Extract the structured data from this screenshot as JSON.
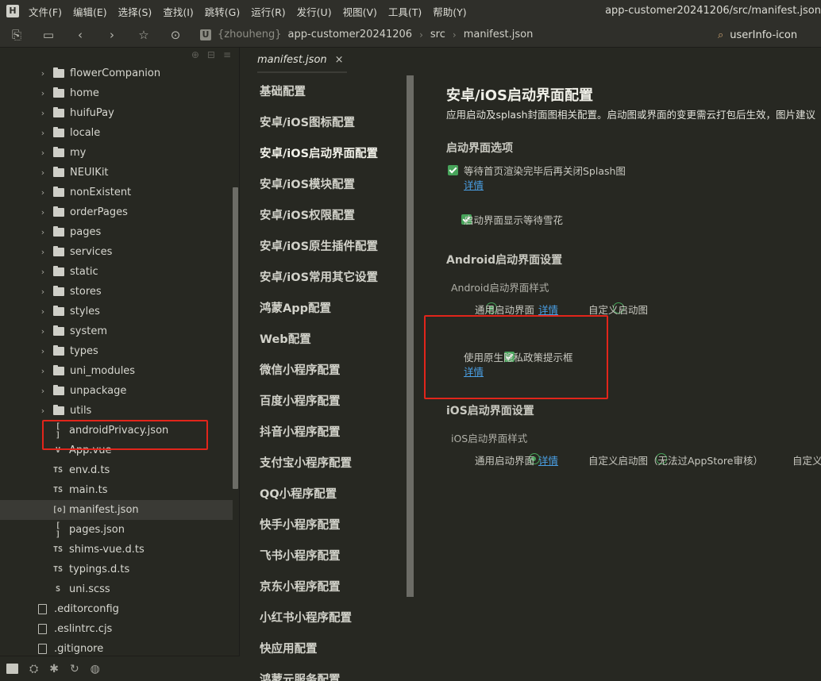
{
  "menubar": {
    "items": [
      "文件(F)",
      "编辑(E)",
      "选择(S)",
      "查找(I)",
      "跳转(G)",
      "运行(R)",
      "发行(U)",
      "视图(V)",
      "工具(T)",
      "帮助(Y)"
    ],
    "window_title": "app-customer20241206/src/manifest.json"
  },
  "toolbar": {
    "breadcrumb": [
      "{zhouheng}",
      "app-customer20241206",
      "src",
      "manifest.json"
    ],
    "search_text": "userInfo-icon"
  },
  "sidebar": {
    "folders": [
      "flowerCompanion",
      "home",
      "huifuPay",
      "locale",
      "my",
      "NEUIKit",
      "nonExistent",
      "orderPages",
      "pages",
      "services",
      "static",
      "stores",
      "styles",
      "system",
      "types",
      "uni_modules",
      "unpackage",
      "utils"
    ],
    "files": [
      {
        "icon": "[ ]",
        "name": "androidPrivacy.json"
      },
      {
        "icon": "V",
        "name": "App.vue"
      },
      {
        "icon": "TS",
        "name": "env.d.ts"
      },
      {
        "icon": "TS",
        "name": "main.ts"
      },
      {
        "icon": "[o]",
        "name": "manifest.json"
      },
      {
        "icon": "[ ]",
        "name": "pages.json"
      },
      {
        "icon": "TS",
        "name": "shims-vue.d.ts"
      },
      {
        "icon": "TS",
        "name": "typings.d.ts"
      },
      {
        "icon": "S",
        "name": "uni.scss"
      }
    ],
    "root_files": [
      ".editorconfig",
      ".eslintrc.cjs",
      ".gitignore"
    ]
  },
  "tab": {
    "label": "manifest.json",
    "close": "×"
  },
  "nav": {
    "items": [
      "基础配置",
      "安卓/iOS图标配置",
      "安卓/iOS启动界面配置",
      "安卓/iOS模块配置",
      "安卓/iOS权限配置",
      "安卓/iOS原生插件配置",
      "安卓/iOS常用其它设置",
      "鸿蒙App配置",
      "Web配置",
      "微信小程序配置",
      "百度小程序配置",
      "抖音小程序配置",
      "支付宝小程序配置",
      "QQ小程序配置",
      "快手小程序配置",
      "飞书小程序配置",
      "京东小程序配置",
      "小红书小程序配置",
      "快应用配置",
      "鸿蒙元服务配置"
    ],
    "active_index": 2
  },
  "content": {
    "title": "安卓/iOS启动界面配置",
    "description": "应用启动及splash封面图相关配置。启动图或界面的变更需云打包后生效，图片建议",
    "section_options": "启动界面选项",
    "opt_wait_render": "等待首页渲染完毕后再关闭Splash图",
    "detail": "详情",
    "opt_show_snow": "启动界面显示等待雪花",
    "section_android": "Android启动界面设置",
    "android_style_label": "Android启动界面样式",
    "radio_general": "通用启动界面",
    "radio_custom": "自定义启动图",
    "opt_privacy": "使用原生隐私政策提示框",
    "section_ios": "iOS启动界面设置",
    "ios_style_label": "iOS启动界面样式",
    "radio_custom_ios": "自定义启动图（无法过AppStore审核）",
    "radio_custom_ios_2": "自定义"
  },
  "colors": {
    "accent_green": "#47a35a",
    "link_blue": "#4aa0e6",
    "highlight_red": "#e1251b"
  }
}
